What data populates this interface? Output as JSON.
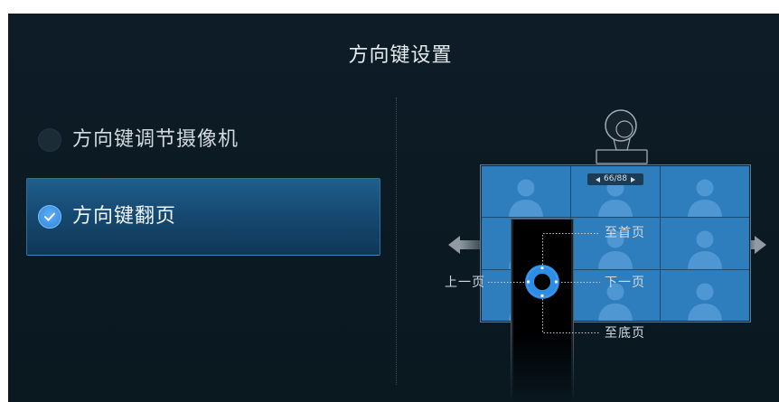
{
  "dialog": {
    "title": "方向键设置"
  },
  "options": [
    {
      "label": "方向键调节摄像机",
      "selected": false
    },
    {
      "label": "方向键翻页",
      "selected": true
    }
  ],
  "illustration": {
    "page_indicator": "66/88",
    "labels": {
      "first_page": "至首页",
      "prev_page": "上一页",
      "next_page": "下一页",
      "last_page": "至底页"
    }
  },
  "icons": [
    "radio-button",
    "check-icon",
    "camera-icon",
    "arrow-left-icon",
    "arrow-right-icon",
    "person-icon",
    "prev-triangle-icon",
    "next-triangle-icon",
    "remote-icon",
    "dpad-icon"
  ],
  "colors": {
    "background": "#0b1922",
    "accent": "#3a93e8",
    "selected_panel": "#1a5280",
    "tile": "#2e7dbd",
    "dpad": "#2d8ce4"
  }
}
